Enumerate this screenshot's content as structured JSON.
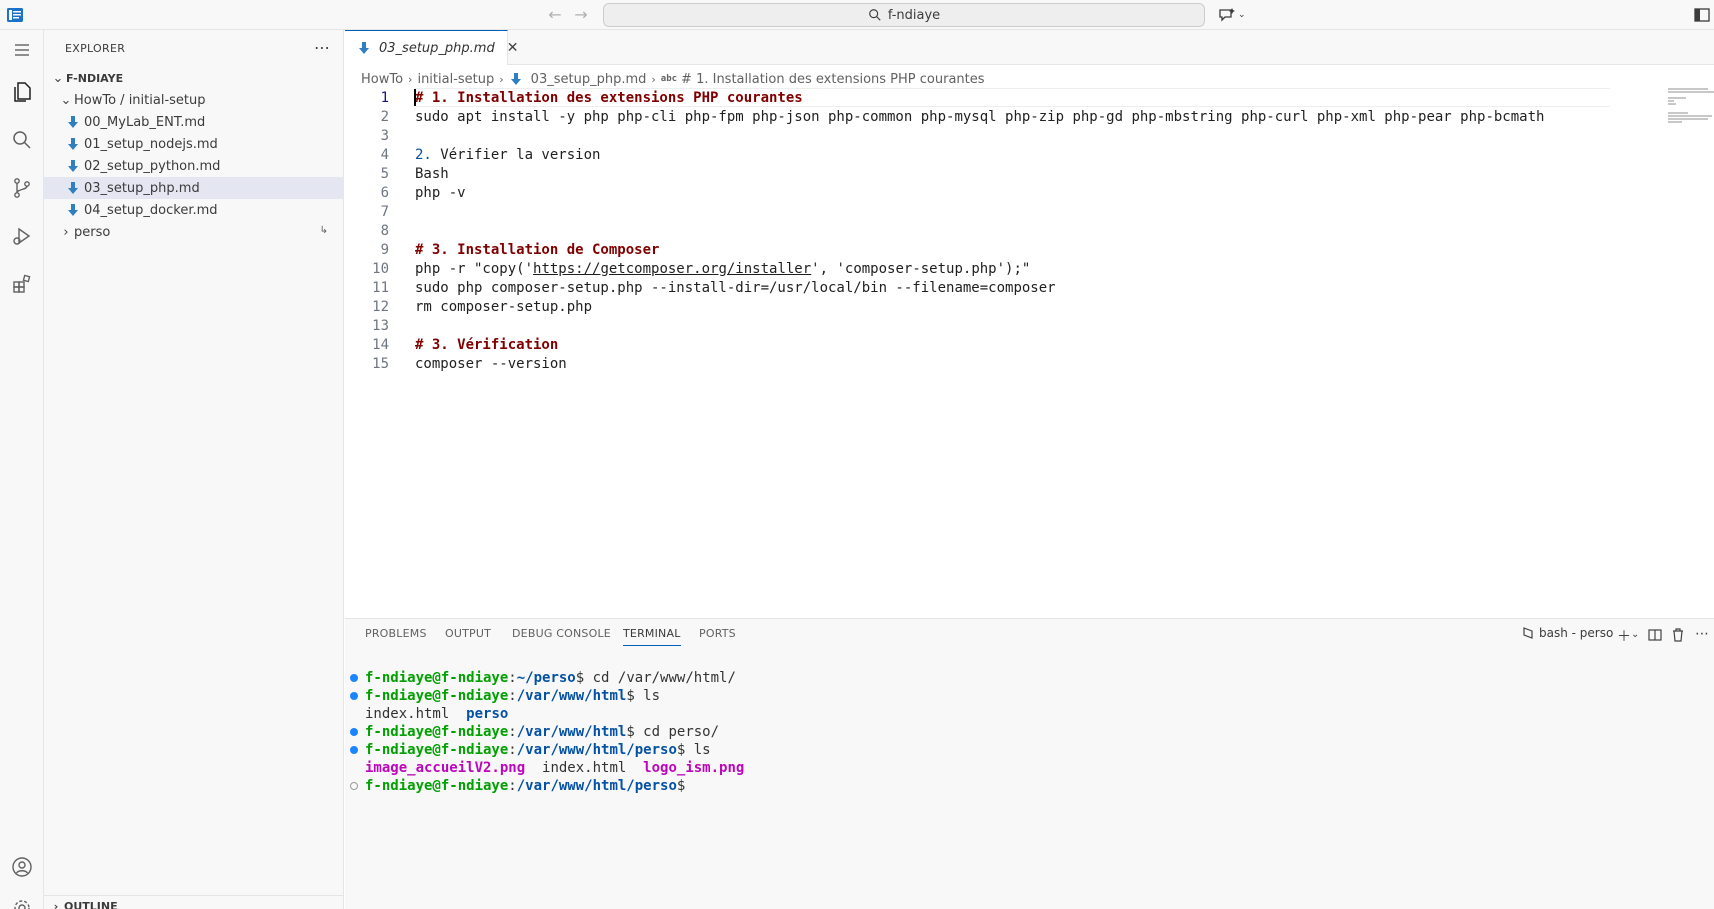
{
  "titlebar": {
    "search_text": "f-ndiaye"
  },
  "sidebar": {
    "header": "EXPLORER",
    "root": "F-NDIAYE",
    "folder": "HowTo / initial-setup",
    "files": [
      "00_MyLab_ENT.md",
      "01_setup_nodejs.md",
      "02_setup_python.md",
      "03_setup_php.md",
      "04_setup_docker.md"
    ],
    "perso": "perso",
    "outline": "OUTLINE"
  },
  "editor": {
    "tab_label": "03_setup_php.md",
    "breadcrumb": [
      "HowTo",
      "initial-setup",
      "03_setup_php.md",
      "# 1. Installation des extensions PHP courantes"
    ],
    "lines": [
      {
        "n": "1",
        "text": "# 1. Installation des extensions PHP courantes"
      },
      {
        "n": "2",
        "text": "sudo apt install -y php php-cli php-fpm php-json php-common php-mysql php-zip php-gd php-mbstring php-curl php-xml php-pear php-bcmath"
      },
      {
        "n": "3",
        "text": ""
      },
      {
        "n": "4",
        "num": "2.",
        "text": " Vérifier la version"
      },
      {
        "n": "5",
        "text": "Bash"
      },
      {
        "n": "6",
        "text": "php -v"
      },
      {
        "n": "7",
        "text": ""
      },
      {
        "n": "8",
        "text": ""
      },
      {
        "n": "9",
        "text": "# 3. Installation de Composer"
      },
      {
        "n": "10",
        "pre": "php -r \"copy('",
        "link": "https://getcomposer.org/installer",
        "post": "', 'composer-setup.php');\""
      },
      {
        "n": "11",
        "text": "sudo php composer-setup.php --install-dir=/usr/local/bin --filename=composer"
      },
      {
        "n": "12",
        "text": "rm composer-setup.php"
      },
      {
        "n": "13",
        "text": ""
      },
      {
        "n": "14",
        "text": "# 3. Vérification"
      },
      {
        "n": "15",
        "text": "composer --version"
      }
    ]
  },
  "panel": {
    "tabs": [
      "PROBLEMS",
      "OUTPUT",
      "DEBUG CONSOLE",
      "TERMINAL",
      "PORTS"
    ],
    "terminal_profile": "bash - perso",
    "terminal": {
      "user": "f-ndiaye@f-ndiaye",
      "l1_path": "~/perso",
      "l1_cmd": " cd /var/www/html/",
      "l2_path": "/var/www/html",
      "l2_cmd": " ls",
      "l3_file": "index.html",
      "l3_dir": "perso",
      "l4_path": "/var/www/html",
      "l4_cmd": " cd perso/",
      "l5_path": "/var/www/html/perso",
      "l5_cmd": " ls",
      "l6_img1": "image_accueilV2.png",
      "l6_file": "index.html",
      "l6_img2": "logo_ism.png",
      "l7_path": "/var/www/html/perso"
    }
  }
}
